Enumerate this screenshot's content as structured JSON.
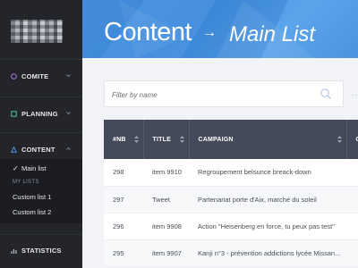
{
  "sidebar": {
    "items": [
      {
        "label": "COMITE",
        "icon": "circle-icon",
        "color": "#a97ad8"
      },
      {
        "label": "PLANNING",
        "icon": "square-icon",
        "color": "#4cc88a"
      },
      {
        "label": "CONTENT",
        "icon": "triangle-icon",
        "color": "#4f9be6"
      },
      {
        "label": "STATISTICS",
        "icon": "bar-chart-icon",
        "color": "#b8bcc4"
      }
    ],
    "submenu": {
      "active_label": "Main list",
      "section_header": "MY LISTS",
      "lists": [
        "Custom list 1",
        "Custom list 2"
      ]
    }
  },
  "header": {
    "title": "Content",
    "arrow": "→",
    "current": "Main List"
  },
  "filter": {
    "placeholder": "Filter by name",
    "value": ""
  },
  "table": {
    "columns": [
      "#NB",
      "TITLE",
      "CAMPAIGN",
      "CH"
    ],
    "rows": [
      {
        "nb": "298",
        "title": "item 9910",
        "campaign": "Regroupement belsunce breack-down"
      },
      {
        "nb": "297",
        "title": "Tweet",
        "campaign": "Partenariat porte d'Aix, marché du soleil"
      },
      {
        "nb": "296",
        "title": "item 9908",
        "campaign": "Action \"Heisenberg en force, tu peux pas test\""
      },
      {
        "nb": "295",
        "title": "item 9907",
        "campaign": "Kanji n°3 - prévention addictions lycée Missan..."
      }
    ]
  },
  "colors": {
    "sidebar_bg": "#23252b",
    "header_blue": "#4a93e0",
    "table_header": "#444a59"
  }
}
